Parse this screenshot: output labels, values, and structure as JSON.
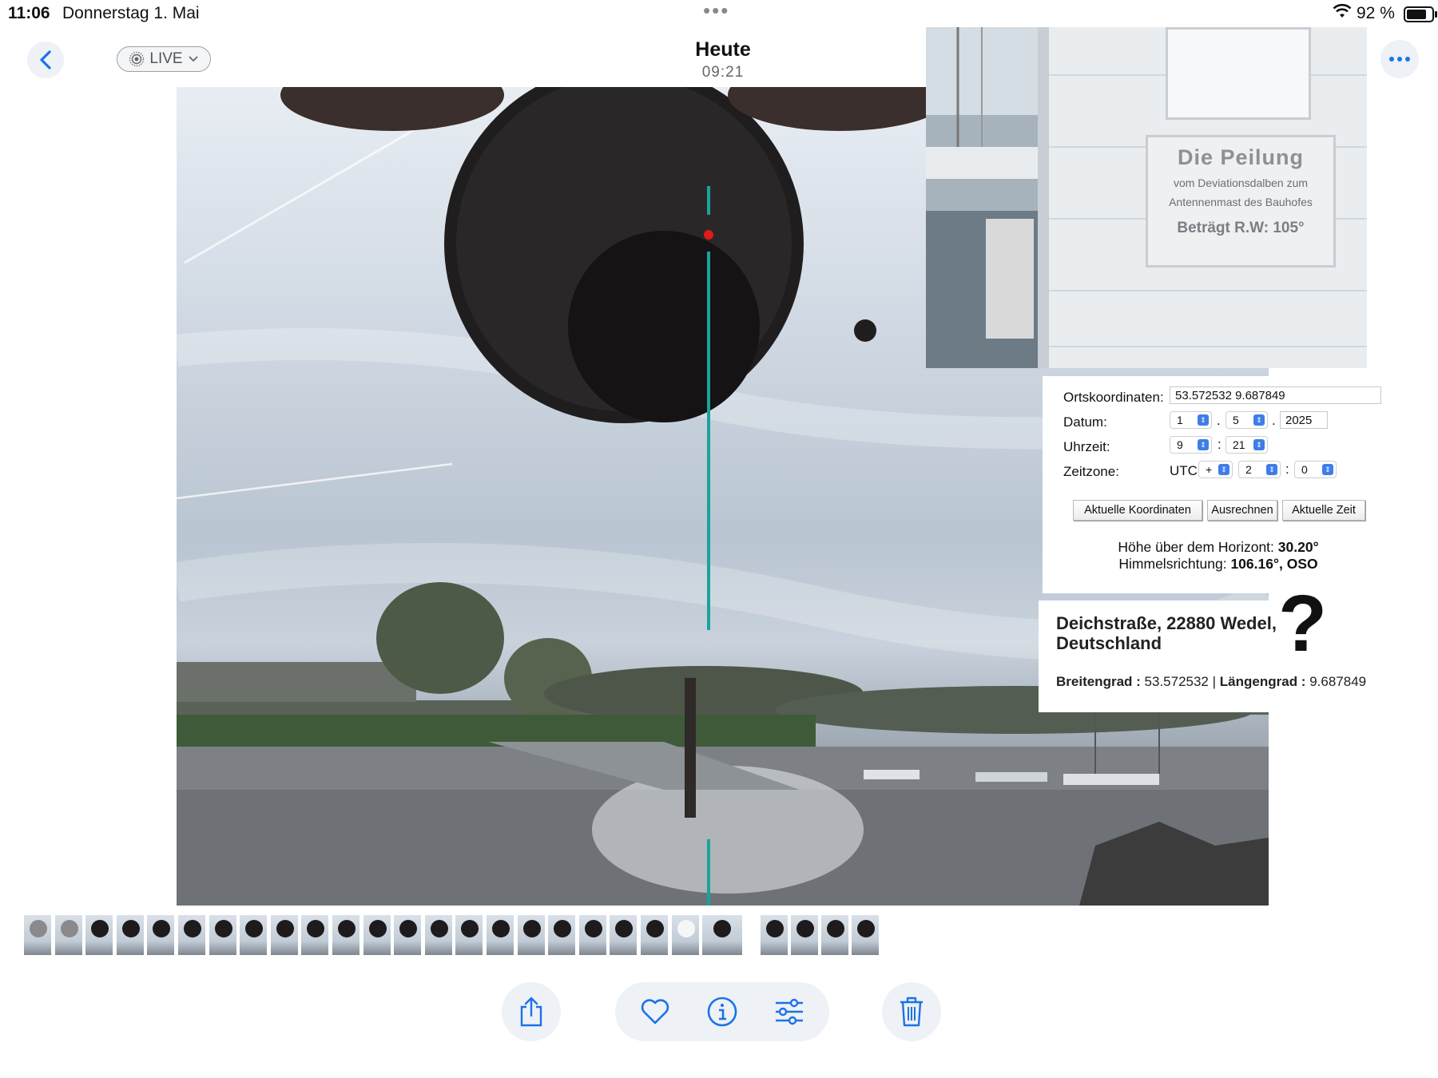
{
  "status_bar": {
    "time": "11:06",
    "date": "Donnerstag 1. Mai",
    "battery": "92 %",
    "battery_level": 0.92
  },
  "nav": {
    "live_label": "LIVE",
    "title": "Heute",
    "subtitle": "09:21"
  },
  "sign": {
    "heading": "Die Peilung",
    "line1": "vom Deviationsdalben zum",
    "line2": "Antennenmast des Bauhofes",
    "bearing": "Beträgt R.W: 105°"
  },
  "calculator": {
    "coords_label": "Ortskoordinaten:",
    "coords_value": "53.572532 9.687849",
    "date_label": "Datum:",
    "date_day": "1",
    "date_month": "5",
    "date_year": "2025",
    "time_label": "Uhrzeit:",
    "time_hour": "9",
    "time_minute": "21",
    "tz_label": "Zeitzone:",
    "tz_prefix": "UTC",
    "tz_sign": "+",
    "tz_hours": "2",
    "tz_minutes": "0",
    "btn_coords": "Aktuelle Koordinaten",
    "btn_calc": "Ausrechnen",
    "btn_time": "Aktuelle Zeit",
    "altitude_label": "Höhe über dem Horizont:",
    "altitude_value": "30.20°",
    "azimuth_label": "Himmelsrichtung:",
    "azimuth_value": "106.16°, OSO"
  },
  "address": {
    "street": "Deichstraße, 22880 Wedel, Deutschland",
    "question_mark": "?",
    "lat_label": "Breitengrad :",
    "lat_value": "53.572532",
    "divider": "|",
    "lon_label": "Längengrad :",
    "lon_value": "9.687849"
  },
  "colors": {
    "accent": "#1a73e8",
    "sun_line": "#1aa39a",
    "sun_dot": "#e01b1b"
  }
}
